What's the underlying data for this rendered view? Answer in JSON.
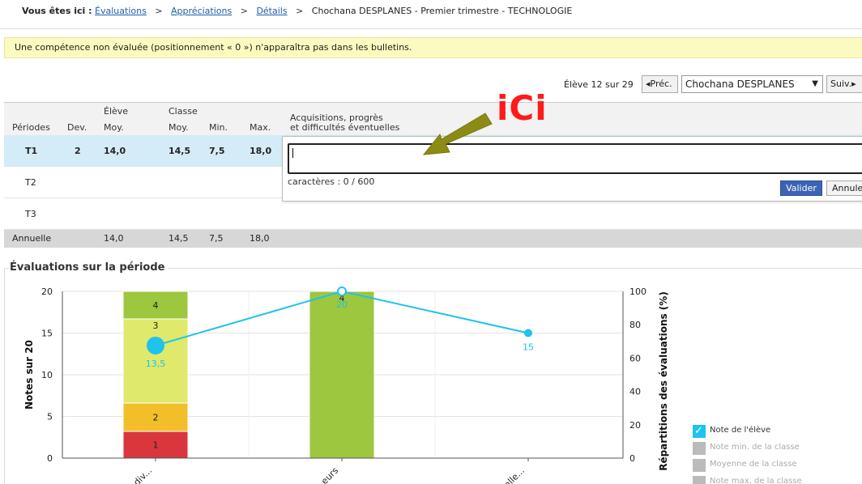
{
  "breadcrumb": {
    "label": "Vous êtes ici :",
    "links": [
      "Évaluations",
      "Appréciations",
      "Détails"
    ],
    "current": "Chochana DESPLANES - Premier trimestre - TECHNOLOGIE",
    "separator": ">"
  },
  "notice": "Une compétence non évaluée (positionnement « 0 ») n'apparaîtra pas dans les bulletins.",
  "navigation": {
    "count": "Élève 12 sur 29",
    "prev_label": "Préc.",
    "student_selected": "Chochana DESPLANES",
    "next_label": "Suiv."
  },
  "table": {
    "headers": {
      "periods": "Périodes",
      "dev": "Dev.",
      "eleve_group": "Élève",
      "eleve_moy": "Moy.",
      "classe_group": "Classe",
      "classe_moy": "Moy.",
      "classe_min": "Min.",
      "classe_max": "Max.",
      "acquisitions_1": "Acquisitions, progrès",
      "acquisitions_2": "et difficultés éventuelles"
    },
    "rows": [
      {
        "period": "T1",
        "dev": "2",
        "moy": "14,0",
        "cmoy": "14,5",
        "cmin": "7,5",
        "cmax": "18,0"
      },
      {
        "period": "T2",
        "dev": "",
        "moy": "",
        "cmoy": "",
        "cmin": "",
        "cmax": ""
      },
      {
        "period": "T3",
        "dev": "",
        "moy": "",
        "cmoy": "",
        "cmin": "",
        "cmax": ""
      }
    ],
    "annual": {
      "period": "Annuelle",
      "moy": "14,0",
      "cmoy": "14,5",
      "cmin": "7,5",
      "cmax": "18,0"
    }
  },
  "comment_editor": {
    "value": "",
    "char_count": "caractères : 0 / 600",
    "validate_label": "Valider",
    "cancel_label": "Annuler"
  },
  "annotation": {
    "text": "iCi",
    "color": "#ff1a1a",
    "arrow_color": "#8c8c14"
  },
  "chart_title": "Évaluations sur la période",
  "chart_data": {
    "type": "bar",
    "ylabel": "Notes sur 20",
    "y2label": "Répartitions des évaluations (%)",
    "ylim": [
      0,
      20
    ],
    "y2lim": [
      0,
      100
    ],
    "yticks": [
      "0",
      "5",
      "10",
      "15",
      "20"
    ],
    "y2ticks": [
      "0",
      "20",
      "40",
      "60",
      "80",
      "100"
    ],
    "categories": [
      "...div...",
      "...eurs",
      "...elle..."
    ],
    "stacked_bars": [
      {
        "category_index": 0,
        "segments": [
          {
            "label": "1",
            "value": 3.2,
            "color": "#d9363e"
          },
          {
            "label": "2",
            "value": 3.4,
            "color": "#f2bf2a"
          },
          {
            "label": "3",
            "value": 10.1,
            "color": "#dfe96c"
          },
          {
            "label": "4",
            "value": 3.3,
            "color": "#9cc73e"
          }
        ]
      },
      {
        "category_index": 1,
        "segments": [
          {
            "label": "4",
            "value": 20,
            "color": "#9cc73e"
          }
        ]
      }
    ],
    "series": [
      {
        "name": "Note de l'élève",
        "values": [
          13.5,
          20,
          15
        ],
        "labels": [
          "13,5",
          "20",
          "15"
        ],
        "color": "#1ec3ee"
      }
    ],
    "grid": true
  },
  "legend": {
    "items": [
      {
        "label": "Note de l'élève",
        "active": true
      },
      {
        "label": "Note min. de la classe",
        "active": false
      },
      {
        "label": "Moyenne de la classe",
        "active": false
      },
      {
        "label": "Note max. de la classe",
        "active": false
      }
    ]
  }
}
